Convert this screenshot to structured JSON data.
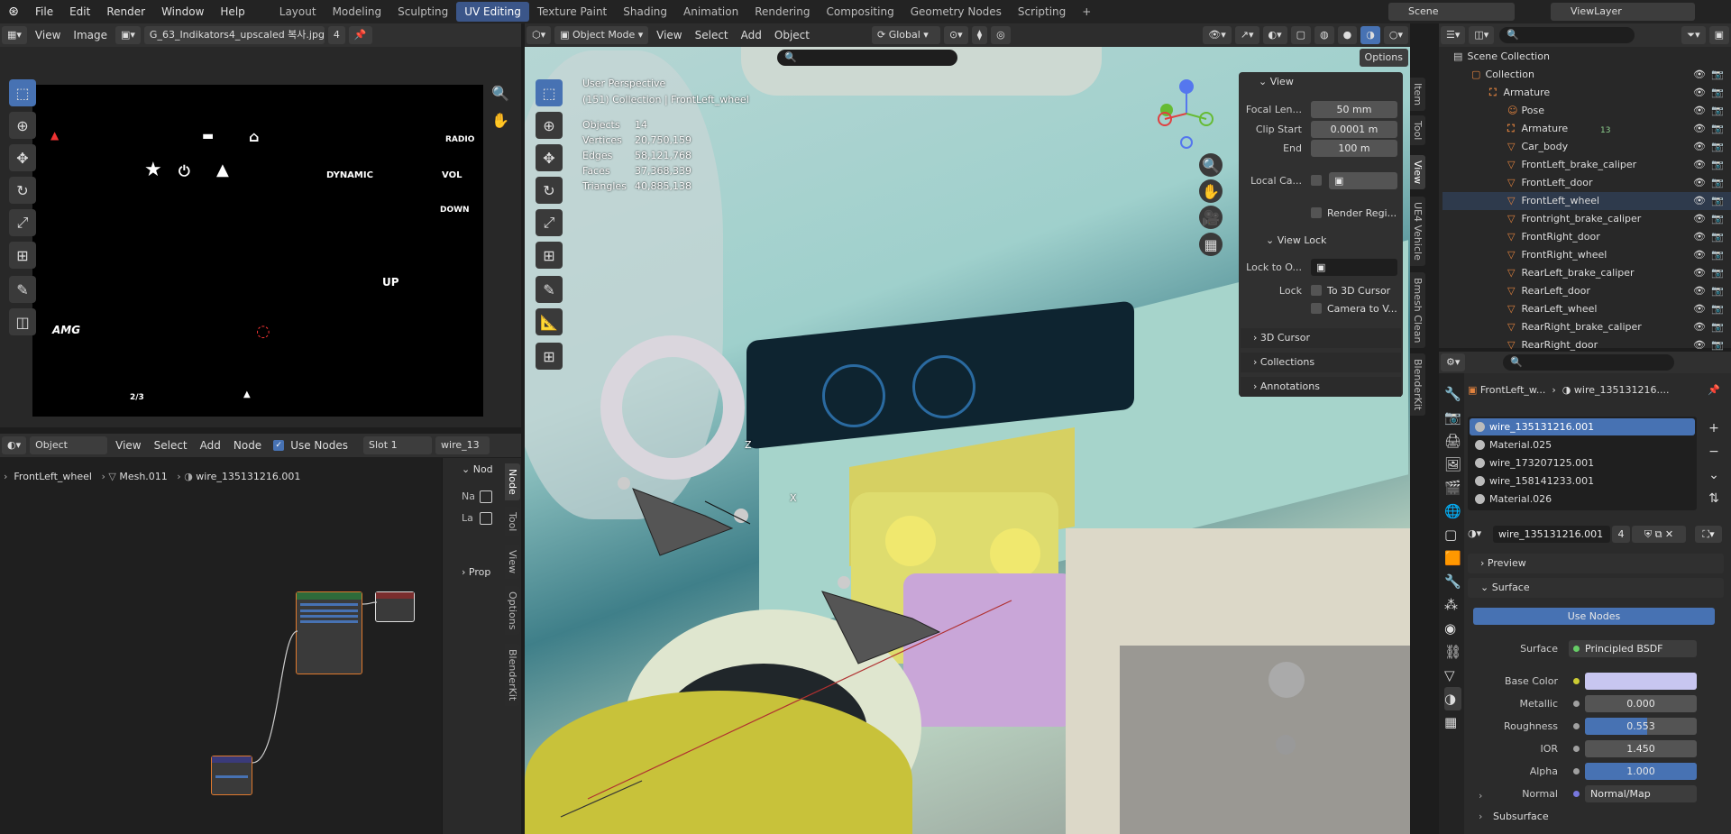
{
  "topbar": {
    "menus": [
      "File",
      "Edit",
      "Render",
      "Window",
      "Help"
    ],
    "workspaces": [
      "Layout",
      "Modeling",
      "Sculpting",
      "UV Editing",
      "Texture Paint",
      "Shading",
      "Animation",
      "Rendering",
      "Compositing",
      "Geometry Nodes",
      "Scripting"
    ],
    "active_workspace": "UV Editing",
    "scene": "Scene",
    "view_layer": "ViewLayer"
  },
  "image_editor": {
    "view_label": "View",
    "image_label": "Image",
    "filename": "G_63_Indikators4_upscaled 복사.jpg",
    "users": "4",
    "glyphs": [
      "DYNAMIC",
      "VOL",
      "DOWN",
      "UP",
      "RADIO",
      "AMG",
      "2/3"
    ]
  },
  "node_editor": {
    "object_label": "Object",
    "view": "View",
    "select": "Select",
    "add": "Add",
    "node": "Node",
    "use_nodes": "Use Nodes",
    "slot": "Slot 1",
    "material": "wire_13",
    "breadcrumb": [
      "FrontLeft_wheel",
      "Mesh.011",
      "wire_135131216.001"
    ],
    "side_tabs": [
      "Node",
      "Tool",
      "View",
      "Options",
      "BlenderKit"
    ],
    "side_node": "Nod",
    "side_na": "Na",
    "side_la": "La",
    "side_prop": "Prop"
  },
  "viewport": {
    "mode": "Object Mode",
    "menus": [
      "View",
      "Select",
      "Add",
      "Object"
    ],
    "orientation": "Global",
    "perspective": "User Perspective",
    "collection_line": "(151) Collection | FrontLeft_wheel",
    "stats": [
      {
        "label": "Objects",
        "value": "14"
      },
      {
        "label": "Vertices",
        "value": "20,750,159"
      },
      {
        "label": "Edges",
        "value": "58,121,768"
      },
      {
        "label": "Faces",
        "value": "37,368,339"
      },
      {
        "label": "Triangles",
        "value": "40,885,138"
      }
    ],
    "options": "Options",
    "axes": {
      "x": "X",
      "y": "Y",
      "z": "Z"
    }
  },
  "npanel": {
    "view_title": "View",
    "focal_label": "Focal Len...",
    "focal_value": "50 mm",
    "clip_start_label": "Clip Start",
    "clip_start_value": "0.0001 m",
    "end_label": "End",
    "end_value": "100 m",
    "local_camera": "Local Ca...",
    "render_region": "Render Regi...",
    "view_lock": "View Lock",
    "lock_to": "Lock to O...",
    "lock_label": "Lock",
    "to_3d_cursor": "To 3D Cursor",
    "camera_to_view": "Camera to V...",
    "cursor": "3D Cursor",
    "collections": "Collections",
    "annotations": "Annotations",
    "tabs": [
      "Item",
      "Tool",
      "View",
      "UE4 Vehicle",
      "Bmesh Clean",
      "BlenderKit"
    ]
  },
  "outliner": {
    "scene_collection": "Scene Collection",
    "rows": [
      {
        "name": "Collection",
        "indent": 1,
        "icon": "▢"
      },
      {
        "name": "Armature",
        "indent": 2,
        "icon": "⛶"
      },
      {
        "name": "Pose",
        "indent": 3,
        "icon": "☺"
      },
      {
        "name": "Armature",
        "indent": 3,
        "icon": "⛶"
      },
      {
        "name": "Car_body",
        "indent": 3,
        "icon": "▽"
      },
      {
        "name": "FrontLeft_brake_caliper",
        "indent": 3,
        "icon": "▽"
      },
      {
        "name": "FrontLeft_door",
        "indent": 3,
        "icon": "▽"
      },
      {
        "name": "FrontLeft_wheel",
        "indent": 3,
        "icon": "▽"
      },
      {
        "name": "Frontright_brake_caliper",
        "indent": 3,
        "icon": "▽"
      },
      {
        "name": "FrontRight_door",
        "indent": 3,
        "icon": "▽"
      },
      {
        "name": "FrontRight_wheel",
        "indent": 3,
        "icon": "▽"
      },
      {
        "name": "RearLeft_brake_caliper",
        "indent": 3,
        "icon": "▽"
      },
      {
        "name": "RearLeft_door",
        "indent": 3,
        "icon": "▽"
      },
      {
        "name": "RearLeft_wheel",
        "indent": 3,
        "icon": "▽"
      },
      {
        "name": "RearRight_brake_caliper",
        "indent": 3,
        "icon": "▽"
      },
      {
        "name": "RearRight_door",
        "indent": 3,
        "icon": "▽"
      }
    ],
    "armature_count": "13"
  },
  "properties": {
    "object": "FrontLeft_w...",
    "material": "wire_135131216....",
    "slots": [
      "wire_135131216.001",
      "Material.025",
      "wire_173207125.001",
      "wire_158141233.001",
      "Material.026"
    ],
    "mat_name": "wire_135131216.001",
    "mat_users": "4",
    "preview": "Preview",
    "surface_section": "Surface",
    "use_nodes": "Use Nodes",
    "surface_label": "Surface",
    "surface_value": "Principled BSDF",
    "base_color_label": "Base Color",
    "metallic_label": "Metallic",
    "metallic_value": "0.000",
    "roughness_label": "Roughness",
    "roughness_value": "0.553",
    "roughness_level": 0.553,
    "ior_label": "IOR",
    "ior_value": "1.450",
    "alpha_label": "Alpha",
    "alpha_value": "1.000",
    "alpha_level": 1.0,
    "normal_label": "Normal",
    "normal_value": "Normal/Map",
    "subsurface": "Subsurface",
    "base_color": "#c8c6f0"
  }
}
